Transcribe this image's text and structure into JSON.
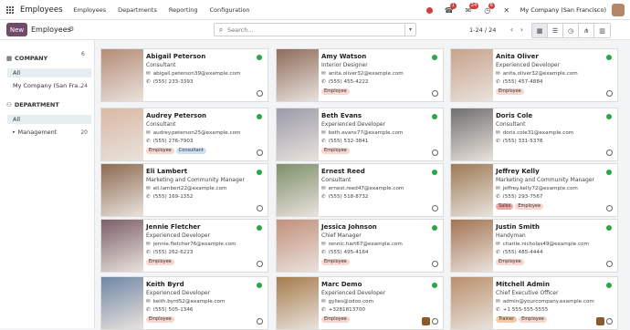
{
  "navbar": {
    "app_name": "Employees",
    "menu": [
      "Employees",
      "Departments",
      "Reporting",
      "Configuration"
    ],
    "phone_badge": "1",
    "chat_badge": "24",
    "activity_badge": "6",
    "company": "My Company (San Francisco)"
  },
  "control_panel": {
    "new_label": "New",
    "breadcrumb": "Employees",
    "search_placeholder": "Search...",
    "pager": "1-24 / 24"
  },
  "sidebar": {
    "company_heading": "COMPANY",
    "company_count": "6",
    "company_items": [
      {
        "label": "All",
        "count": ""
      },
      {
        "label": "My Company (San Fra...",
        "count": "24"
      }
    ],
    "department_heading": "DEPARTMENT",
    "department_items": [
      {
        "label": "All",
        "count": ""
      },
      {
        "label": "Management",
        "count": "20"
      }
    ]
  },
  "colors": {
    "accent": "#714b67",
    "status_online": "#28a745",
    "selected_filter": "#e5eef0"
  },
  "employees": [
    {
      "name": "Abigail Peterson",
      "job": "Consultant",
      "email": "abigail.peterson39@example.com",
      "phone": "(555) 233-3393",
      "tags": []
    },
    {
      "name": "Amy Watson",
      "job": "Interior Designer",
      "email": "anita.oliver32@example.com",
      "phone": "(555) 455-4222",
      "tags": [
        "Employee"
      ]
    },
    {
      "name": "Anita Oliver",
      "job": "Experienced Developer",
      "email": "anita.oliver32@example.com",
      "phone": "(555) 457-4884",
      "tags": [
        "Employee"
      ]
    },
    {
      "name": "Audrey Peterson",
      "job": "Consultant",
      "email": "audrey.peterson25@example.com",
      "phone": "(555) 276-7903",
      "tags": [
        "Employee",
        "Consultant"
      ]
    },
    {
      "name": "Beth Evans",
      "job": "Experienced Developer",
      "email": "beth.evans77@example.com",
      "phone": "(555) 532-3841",
      "tags": [
        "Employee"
      ]
    },
    {
      "name": "Doris Cole",
      "job": "Consultant",
      "email": "doris.cole31@example.com",
      "phone": "(555) 331-5378",
      "tags": []
    },
    {
      "name": "Eli Lambert",
      "job": "Marketing and Community Manager",
      "email": "eli.lambert22@example.com",
      "phone": "(555) 169-1352",
      "tags": []
    },
    {
      "name": "Ernest Reed",
      "job": "Consultant",
      "email": "ernest.reed47@example.com",
      "phone": "(555) 518-8732",
      "tags": []
    },
    {
      "name": "Jeffrey Kelly",
      "job": "Marketing and Community Manager",
      "email": "jeffrey.kelly72@example.com",
      "phone": "(555) 293-7567",
      "tags": [
        "Sales",
        "Employee"
      ]
    },
    {
      "name": "Jennie Fletcher",
      "job": "Experienced Developer",
      "email": "jennie.fletcher76@example.com",
      "phone": "(555) 262-6223",
      "tags": [
        "Employee"
      ]
    },
    {
      "name": "Jessica Johnson",
      "job": "Chief Manager",
      "email": "rennic.hart67@example.com",
      "phone": "(555) 495-4164",
      "tags": [
        "Employee"
      ]
    },
    {
      "name": "Justin Smith",
      "job": "Handyman",
      "email": "charlie.nicholas49@example.com",
      "phone": "(555) 485-4444",
      "tags": [
        "Employee"
      ]
    },
    {
      "name": "Keith Byrd",
      "job": "Experienced Developer",
      "email": "keith.byrd52@example.com",
      "phone": "(555) 505-1346",
      "tags": [
        "Employee"
      ]
    },
    {
      "name": "Marc Demo",
      "job": "Experienced Developer",
      "email": "gylies@odoo.com",
      "phone": "+3281813700",
      "tags": [
        "Employee"
      ]
    },
    {
      "name": "Mitchell Admin",
      "job": "Chief Executive Officer",
      "email": "admin@yourcompany.example.com",
      "phone": "+1 555-555-5555",
      "tags": [
        "Trainer",
        "Employee"
      ]
    }
  ]
}
